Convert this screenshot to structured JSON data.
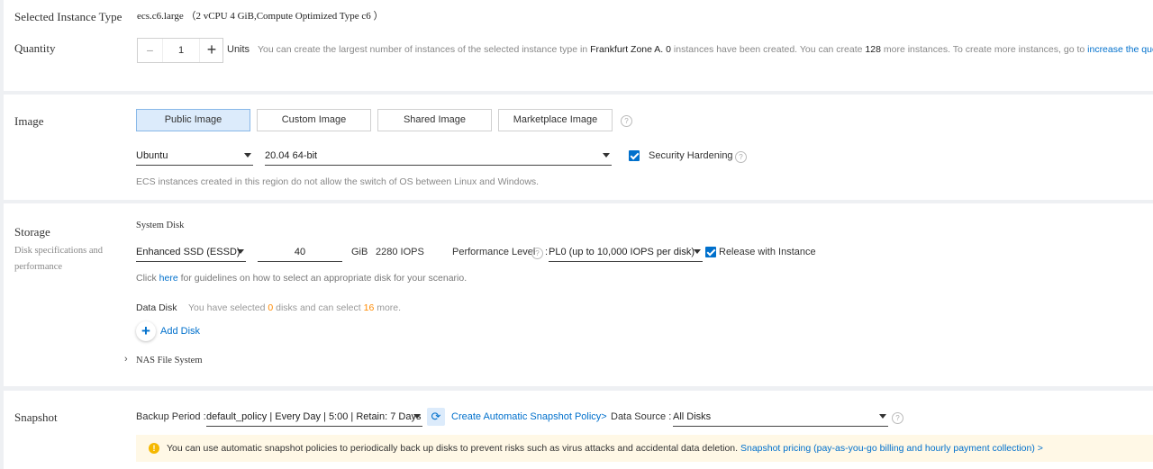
{
  "instance": {
    "label": "Selected Instance Type",
    "value": "ecs.c6.large （2 vCPU 4 GiB,Compute Optimized Type c6 ）"
  },
  "quantity": {
    "label": "Quantity",
    "value": "1",
    "minus": "−",
    "plus": "+",
    "units": "Units",
    "note_prefix": "You can create the largest number of instances of the selected instance type in",
    "zone": "Frankfurt Zone A.",
    "created_count": "0",
    "note_mid": "instances have been created. You can create",
    "more_count": "128",
    "note_suffix": "more instances. To create more instances, go to",
    "quota_link": "increase the quota>"
  },
  "image": {
    "label": "Image",
    "tabs": [
      "Public Image",
      "Custom Image",
      "Shared Image",
      "Marketplace Image"
    ],
    "os": "Ubuntu",
    "version": "20.04 64-bit",
    "hardening_label": "Security Hardening",
    "hardening_checked": true,
    "note": "ECS instances created in this region do not allow the switch of OS between Linux and Windows."
  },
  "storage": {
    "label": "Storage",
    "desc_line1": "Disk specifications and",
    "desc_line2": "performance",
    "system_disk_label": "System Disk",
    "disk_type": "Enhanced SSD (ESSD)",
    "size": "40",
    "size_unit": "GiB",
    "iops": "2280 IOPS",
    "perf_label": "Performance Level",
    "perf_colon": ":",
    "perf_value": "PL0 (up to 10,000 IOPS per disk)",
    "release_label": "Release with Instance",
    "release_checked": true,
    "guide_prefix": "Click",
    "guide_link": "here",
    "guide_suffix": "for guidelines on how to select an appropriate disk for your scenario.",
    "data_disk_label": "Data Disk",
    "data_disk_prefix": "You have selected",
    "selected_count": "0",
    "data_disk_mid": "disks and can select",
    "remaining_count": "16",
    "data_disk_suffix": "more.",
    "add_disk": "Add Disk",
    "nas_label": "NAS File System"
  },
  "snapshot": {
    "label": "Snapshot",
    "backup_label": "Backup Period :",
    "backup_value": "default_policy | Every Day | 5:00 | Retain: 7 Days",
    "create_link": "Create Automatic Snapshot Policy>",
    "source_label": "Data Source :",
    "source_value": "All Disks",
    "notice": "You can use automatic snapshot policies to periodically back up disks to prevent risks such as virus attacks and accidental data deletion.",
    "pricing_link": "Snapshot pricing (pay-as-you-go billing and hourly payment collection) >"
  },
  "colors": {
    "accent": "#0070cc",
    "warning": "#f5b800",
    "count_highlight": "#ff8a00",
    "notice_bg": "#fff8e6"
  }
}
